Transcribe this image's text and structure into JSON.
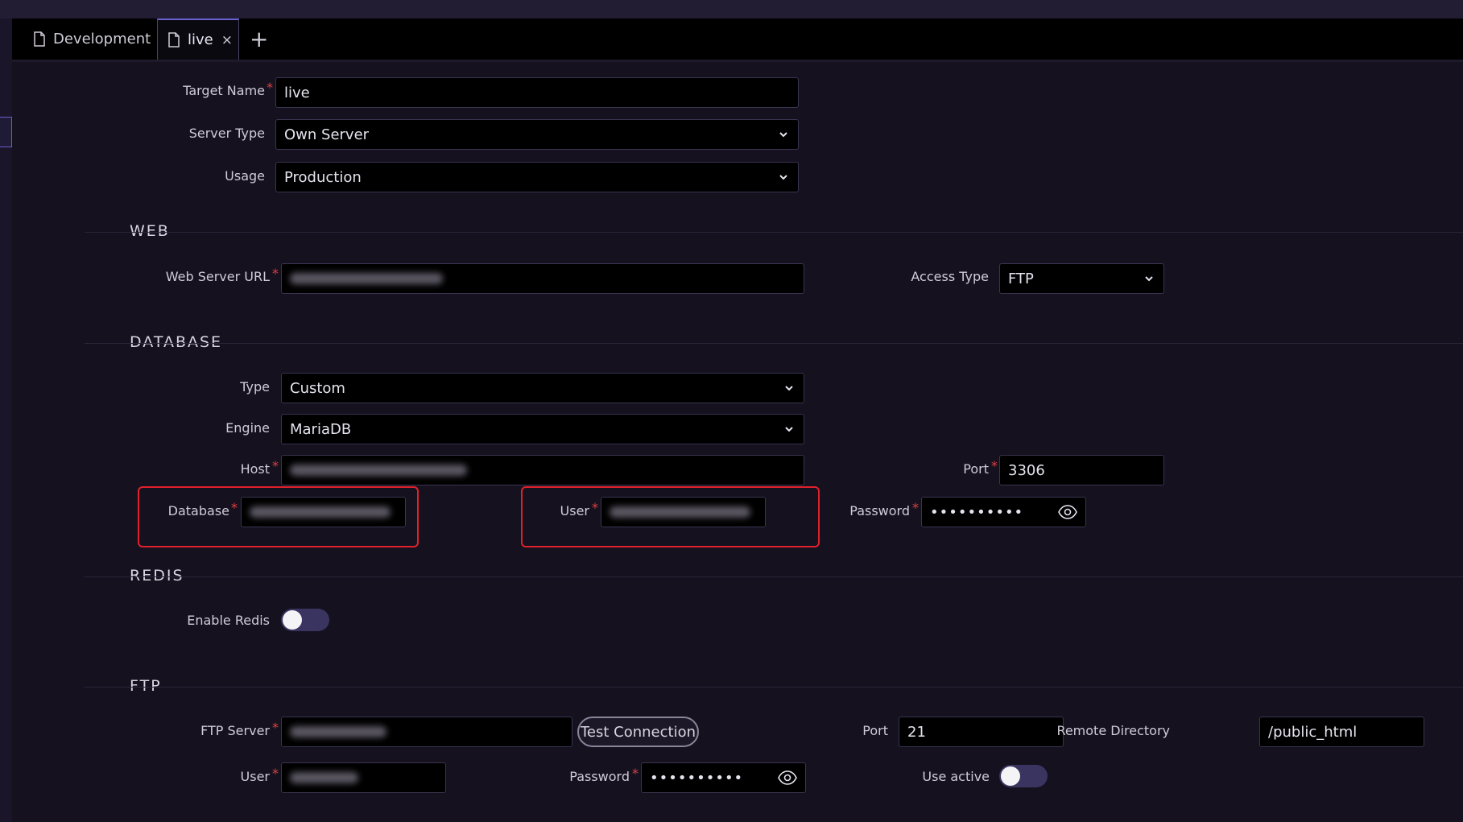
{
  "tabs": [
    {
      "label": "Development",
      "active": false
    },
    {
      "label": "live",
      "active": true,
      "close": "×"
    }
  ],
  "add_tab": "+",
  "general": {
    "target_name": {
      "label": "Target Name",
      "value": "live"
    },
    "server_type": {
      "label": "Server Type",
      "value": "Own Server"
    },
    "usage": {
      "label": "Usage",
      "value": "Production"
    }
  },
  "web": {
    "title": "WEB",
    "server_url": {
      "label": "Web Server URL"
    },
    "access_type": {
      "label": "Access Type",
      "value": "FTP"
    }
  },
  "database": {
    "title": "DATABASE",
    "type": {
      "label": "Type",
      "value": "Custom"
    },
    "engine": {
      "label": "Engine",
      "value": "MariaDB"
    },
    "host": {
      "label": "Host"
    },
    "port": {
      "label": "Port",
      "value": "3306"
    },
    "database": {
      "label": "Database"
    },
    "user": {
      "label": "User"
    },
    "password": {
      "label": "Password",
      "value": "••••••••••"
    }
  },
  "redis": {
    "title": "REDIS",
    "enable": {
      "label": "Enable Redis",
      "on": false
    }
  },
  "ftp": {
    "title": "FTP",
    "server": {
      "label": "FTP Server"
    },
    "test_button": "Test Connection",
    "port": {
      "label": "Port",
      "value": "21"
    },
    "remote_dir": {
      "label": "Remote Directory",
      "value": "/public_html"
    },
    "user": {
      "label": "User"
    },
    "password": {
      "label": "Password",
      "value": "••••••••••"
    },
    "use_active": {
      "label": "Use active",
      "on": false
    }
  },
  "required_marker": "*",
  "colors": {
    "accent": "#6a5fd0",
    "required": "#e04040",
    "highlight_box": "#e0202a"
  }
}
